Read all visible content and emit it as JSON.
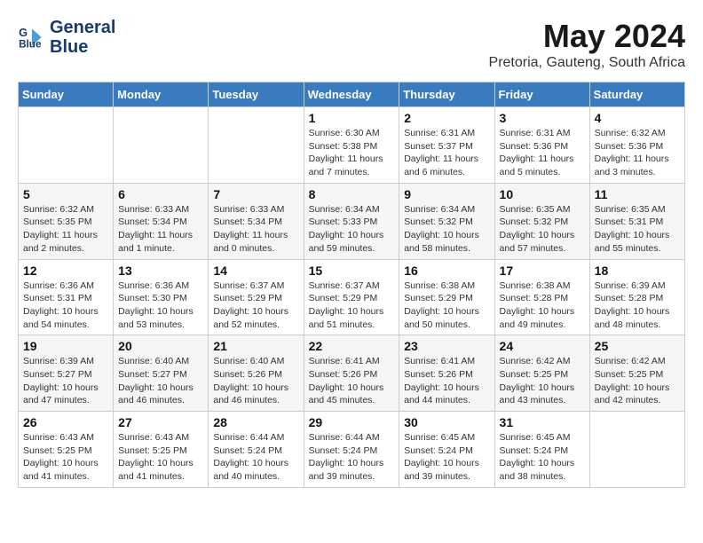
{
  "logo": {
    "line1": "General",
    "line2": "Blue"
  },
  "header": {
    "title": "May 2024",
    "subtitle": "Pretoria, Gauteng, South Africa"
  },
  "weekdays": [
    "Sunday",
    "Monday",
    "Tuesday",
    "Wednesday",
    "Thursday",
    "Friday",
    "Saturday"
  ],
  "weeks": [
    [
      {
        "day": "",
        "info": ""
      },
      {
        "day": "",
        "info": ""
      },
      {
        "day": "",
        "info": ""
      },
      {
        "day": "1",
        "info": "Sunrise: 6:30 AM\nSunset: 5:38 PM\nDaylight: 11 hours\nand 7 minutes."
      },
      {
        "day": "2",
        "info": "Sunrise: 6:31 AM\nSunset: 5:37 PM\nDaylight: 11 hours\nand 6 minutes."
      },
      {
        "day": "3",
        "info": "Sunrise: 6:31 AM\nSunset: 5:36 PM\nDaylight: 11 hours\nand 5 minutes."
      },
      {
        "day": "4",
        "info": "Sunrise: 6:32 AM\nSunset: 5:36 PM\nDaylight: 11 hours\nand 3 minutes."
      }
    ],
    [
      {
        "day": "5",
        "info": "Sunrise: 6:32 AM\nSunset: 5:35 PM\nDaylight: 11 hours\nand 2 minutes."
      },
      {
        "day": "6",
        "info": "Sunrise: 6:33 AM\nSunset: 5:34 PM\nDaylight: 11 hours\nand 1 minute."
      },
      {
        "day": "7",
        "info": "Sunrise: 6:33 AM\nSunset: 5:34 PM\nDaylight: 11 hours\nand 0 minutes."
      },
      {
        "day": "8",
        "info": "Sunrise: 6:34 AM\nSunset: 5:33 PM\nDaylight: 10 hours\nand 59 minutes."
      },
      {
        "day": "9",
        "info": "Sunrise: 6:34 AM\nSunset: 5:32 PM\nDaylight: 10 hours\nand 58 minutes."
      },
      {
        "day": "10",
        "info": "Sunrise: 6:35 AM\nSunset: 5:32 PM\nDaylight: 10 hours\nand 57 minutes."
      },
      {
        "day": "11",
        "info": "Sunrise: 6:35 AM\nSunset: 5:31 PM\nDaylight: 10 hours\nand 55 minutes."
      }
    ],
    [
      {
        "day": "12",
        "info": "Sunrise: 6:36 AM\nSunset: 5:31 PM\nDaylight: 10 hours\nand 54 minutes."
      },
      {
        "day": "13",
        "info": "Sunrise: 6:36 AM\nSunset: 5:30 PM\nDaylight: 10 hours\nand 53 minutes."
      },
      {
        "day": "14",
        "info": "Sunrise: 6:37 AM\nSunset: 5:29 PM\nDaylight: 10 hours\nand 52 minutes."
      },
      {
        "day": "15",
        "info": "Sunrise: 6:37 AM\nSunset: 5:29 PM\nDaylight: 10 hours\nand 51 minutes."
      },
      {
        "day": "16",
        "info": "Sunrise: 6:38 AM\nSunset: 5:29 PM\nDaylight: 10 hours\nand 50 minutes."
      },
      {
        "day": "17",
        "info": "Sunrise: 6:38 AM\nSunset: 5:28 PM\nDaylight: 10 hours\nand 49 minutes."
      },
      {
        "day": "18",
        "info": "Sunrise: 6:39 AM\nSunset: 5:28 PM\nDaylight: 10 hours\nand 48 minutes."
      }
    ],
    [
      {
        "day": "19",
        "info": "Sunrise: 6:39 AM\nSunset: 5:27 PM\nDaylight: 10 hours\nand 47 minutes."
      },
      {
        "day": "20",
        "info": "Sunrise: 6:40 AM\nSunset: 5:27 PM\nDaylight: 10 hours\nand 46 minutes."
      },
      {
        "day": "21",
        "info": "Sunrise: 6:40 AM\nSunset: 5:26 PM\nDaylight: 10 hours\nand 46 minutes."
      },
      {
        "day": "22",
        "info": "Sunrise: 6:41 AM\nSunset: 5:26 PM\nDaylight: 10 hours\nand 45 minutes."
      },
      {
        "day": "23",
        "info": "Sunrise: 6:41 AM\nSunset: 5:26 PM\nDaylight: 10 hours\nand 44 minutes."
      },
      {
        "day": "24",
        "info": "Sunrise: 6:42 AM\nSunset: 5:25 PM\nDaylight: 10 hours\nand 43 minutes."
      },
      {
        "day": "25",
        "info": "Sunrise: 6:42 AM\nSunset: 5:25 PM\nDaylight: 10 hours\nand 42 minutes."
      }
    ],
    [
      {
        "day": "26",
        "info": "Sunrise: 6:43 AM\nSunset: 5:25 PM\nDaylight: 10 hours\nand 41 minutes."
      },
      {
        "day": "27",
        "info": "Sunrise: 6:43 AM\nSunset: 5:25 PM\nDaylight: 10 hours\nand 41 minutes."
      },
      {
        "day": "28",
        "info": "Sunrise: 6:44 AM\nSunset: 5:24 PM\nDaylight: 10 hours\nand 40 minutes."
      },
      {
        "day": "29",
        "info": "Sunrise: 6:44 AM\nSunset: 5:24 PM\nDaylight: 10 hours\nand 39 minutes."
      },
      {
        "day": "30",
        "info": "Sunrise: 6:45 AM\nSunset: 5:24 PM\nDaylight: 10 hours\nand 39 minutes."
      },
      {
        "day": "31",
        "info": "Sunrise: 6:45 AM\nSunset: 5:24 PM\nDaylight: 10 hours\nand 38 minutes."
      },
      {
        "day": "",
        "info": ""
      }
    ]
  ]
}
